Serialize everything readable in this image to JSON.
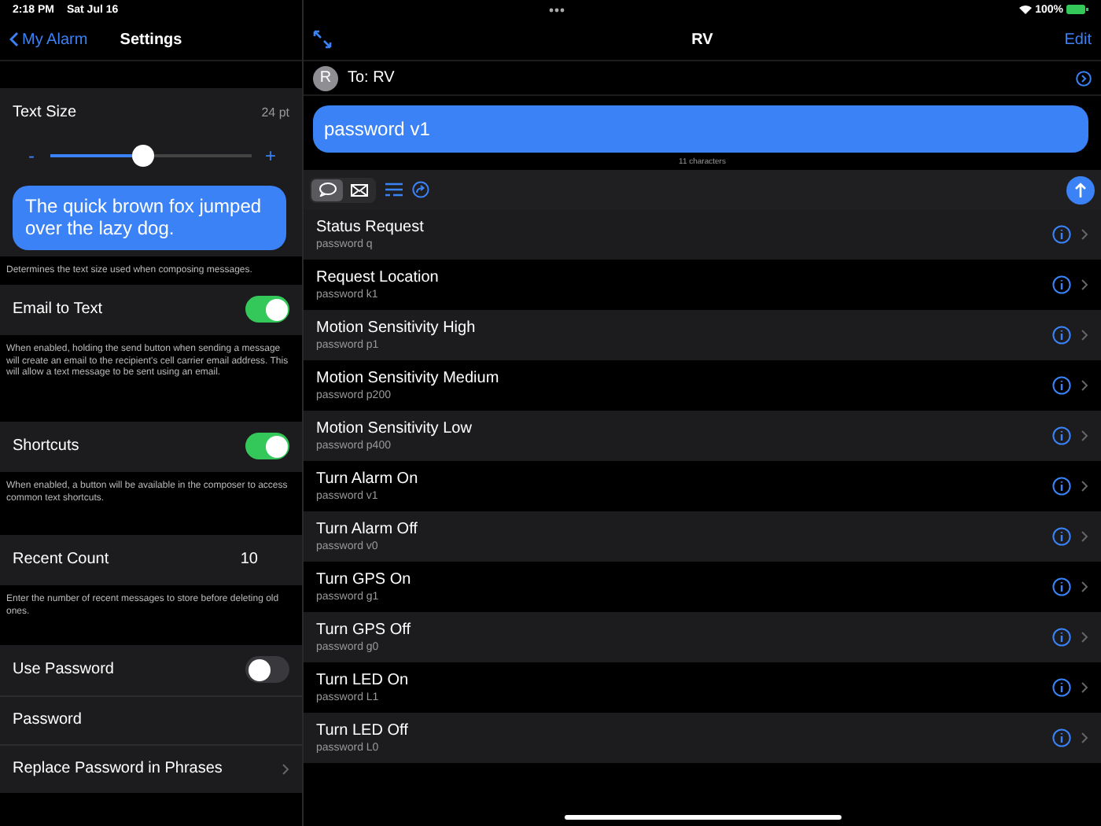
{
  "status_bar": {
    "time": "2:18 PM",
    "date": "Sat Jul 16",
    "battery": "100%"
  },
  "settings": {
    "back_label": "My Alarm",
    "title": "Settings",
    "text_size": {
      "label": "Text Size",
      "reading": "24 pt",
      "minus": "-",
      "plus": "+",
      "level": 0.46,
      "preview": "The quick brown fox jumped over the lazy dog.",
      "footnote": "Determines the text size used when composing messages."
    },
    "email_to_text": {
      "label": "Email to Text",
      "on": true,
      "footnote": "When enabled, holding the send button when sending a message will create an email to the recipient's cell carrier email address. This will allow a text message to be sent using an email."
    },
    "shortcuts": {
      "label": "Shortcuts",
      "on": true,
      "footnote": "When enabled, a button will be available in the composer to access common text shortcuts."
    },
    "recent_count": {
      "label": "Recent Count",
      "value": "10",
      "footnote": "Enter the number of recent messages to store before deleting old ones."
    },
    "password_group": [
      {
        "kind": "toggle",
        "label": "Use Password",
        "on": false
      },
      {
        "kind": "plain",
        "label": "Password"
      },
      {
        "kind": "link",
        "label": "Replace Password in Phrases"
      }
    ]
  },
  "conversation": {
    "title": "RV",
    "edit": "Edit",
    "avatar_initial": "R",
    "to": "To: RV",
    "message": "password v1",
    "char_count": "11 characters",
    "composer_modes": [
      {
        "kind": "message",
        "selected": true
      },
      {
        "kind": "mail",
        "selected": false
      }
    ],
    "shortcuts": [
      {
        "title": "Status Request",
        "command": "password q"
      },
      {
        "title": "Request Location",
        "command": "password k1"
      },
      {
        "title": "Motion Sensitivity High",
        "command": "password p1"
      },
      {
        "title": "Motion Sensitivity Medium",
        "command": "password p200"
      },
      {
        "title": "Motion Sensitivity Low",
        "command": "password p400"
      },
      {
        "title": "Turn Alarm On",
        "command": "password v1"
      },
      {
        "title": "Turn Alarm Off",
        "command": "password v0"
      },
      {
        "title": "Turn GPS On",
        "command": "password g1"
      },
      {
        "title": "Turn GPS Off",
        "command": "password g0"
      },
      {
        "title": "Turn LED On",
        "command": "password L1"
      },
      {
        "title": "Turn LED Off",
        "command": "password L0"
      }
    ]
  }
}
